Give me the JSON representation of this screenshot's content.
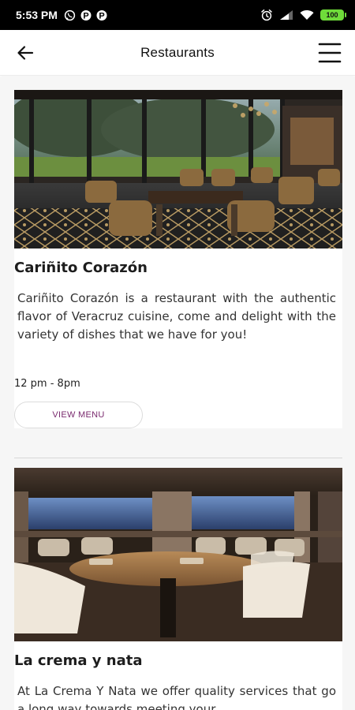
{
  "status_bar": {
    "time": "5:53 PM",
    "battery": "100",
    "icons": [
      "whatsapp-icon",
      "p-app-icon",
      "p-app-icon",
      "alarm-icon",
      "signal-icon",
      "wifi-icon",
      "battery-icon"
    ]
  },
  "app_bar": {
    "title": "Restaurants",
    "back_icon": "arrow-left-icon",
    "menu_icon": "hamburger-menu-icon"
  },
  "restaurants": [
    {
      "name": "Cariñito Corazón",
      "description": "Cariñito Corazón is a restaurant with the authentic flavor of Veracruz cuisine, come and delight with the variety of dishes that we have for you!",
      "hours": "12 pm - 8pm",
      "button_label": "VIEW MENU",
      "image": "restaurant-interior-photo"
    },
    {
      "name": "La crema y nata",
      "description": "At La Crema Y Nata we offer quality services that go a long way towards meeting your",
      "image": "dining-room-photo"
    }
  ],
  "colors": {
    "status_bar_bg": "#000000",
    "battery_green": "#6fdc3a",
    "button_text": "#7a2a6e",
    "page_bg": "#f6f6f6"
  }
}
